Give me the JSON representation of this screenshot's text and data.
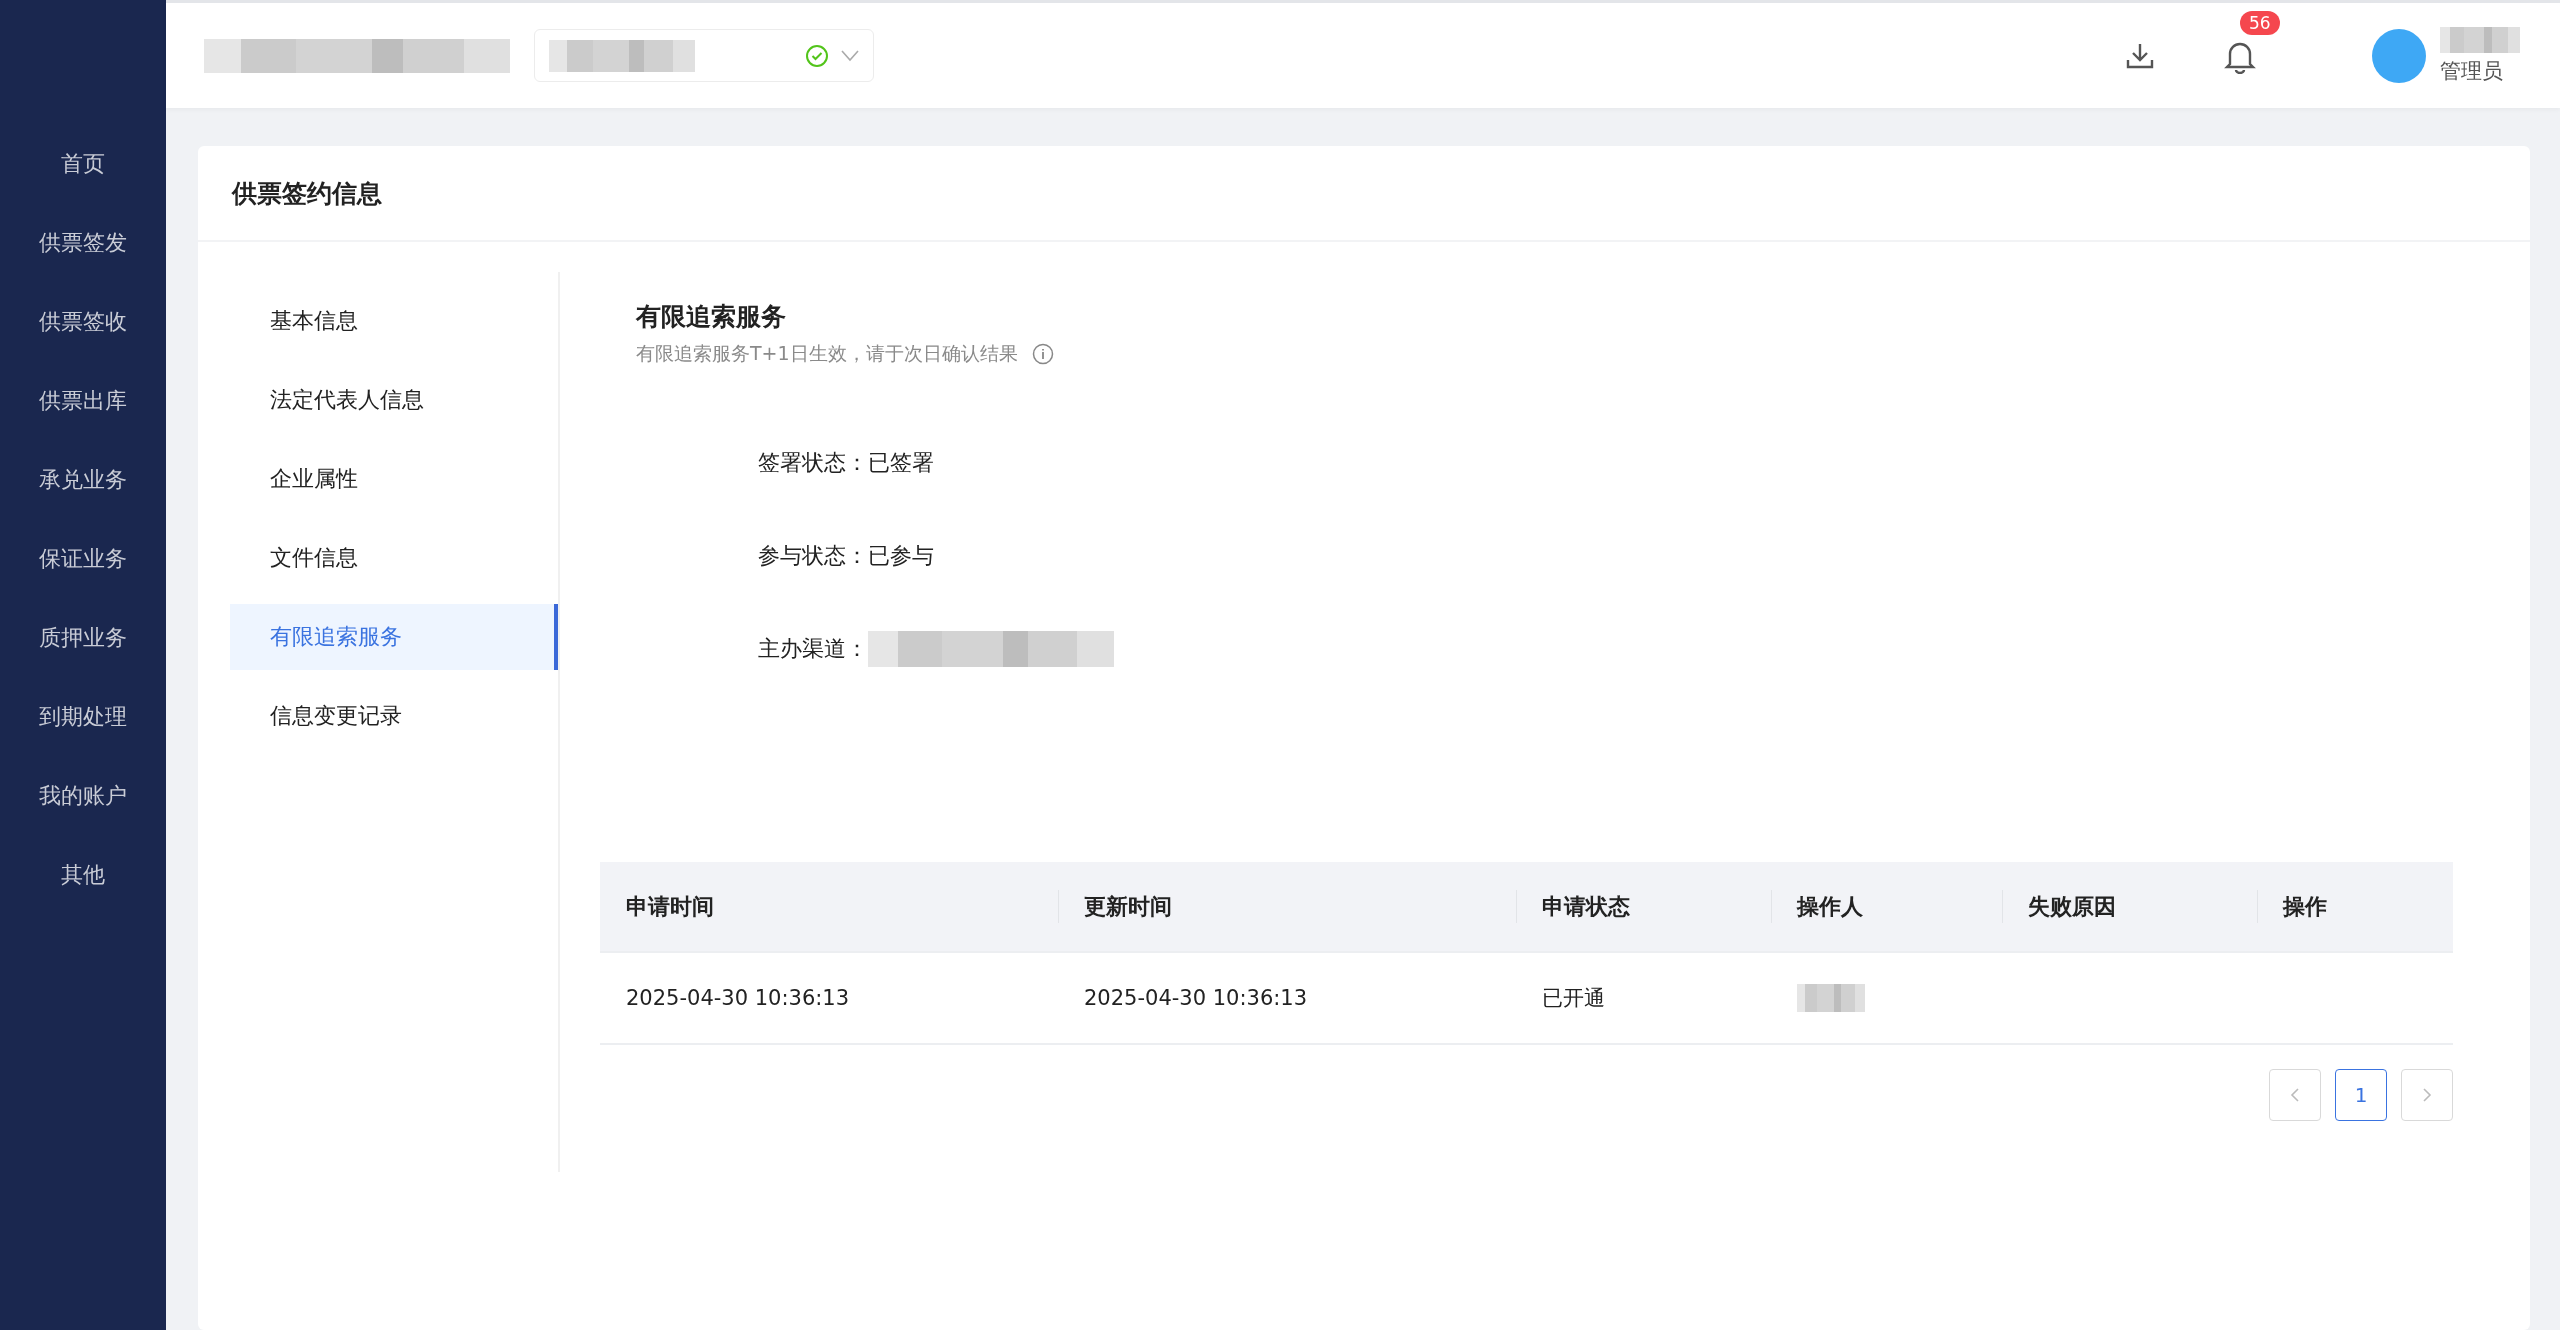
{
  "sidebar": {
    "items": [
      {
        "label": "首页",
        "selected": false
      },
      {
        "label": "供票签发",
        "selected": false
      },
      {
        "label": "供票签收",
        "selected": false
      },
      {
        "label": "供票出库",
        "selected": false
      },
      {
        "label": "承兑业务",
        "selected": false
      },
      {
        "label": "保证业务",
        "selected": false
      },
      {
        "label": "质押业务",
        "selected": false
      },
      {
        "label": "到期处理",
        "selected": false
      },
      {
        "label": "我的账户",
        "selected": false
      },
      {
        "label": "其他",
        "selected": false
      }
    ]
  },
  "header": {
    "notification_count": "56",
    "user_role": "管理员"
  },
  "card": {
    "title": "供票签约信息"
  },
  "sub_nav": {
    "items": [
      {
        "label": "基本信息",
        "selected": false
      },
      {
        "label": "法定代表人信息",
        "selected": false
      },
      {
        "label": "企业属性",
        "selected": false
      },
      {
        "label": "文件信息",
        "selected": false
      },
      {
        "label": "有限追索服务",
        "selected": true
      },
      {
        "label": "信息变更记录",
        "selected": false
      }
    ]
  },
  "section": {
    "title": "有限追索服务",
    "hint": "有限追索服务T+1日生效，请于次日确认结果"
  },
  "fields": [
    {
      "label": "签署状态：",
      "value": "已签署"
    },
    {
      "label": "参与状态：",
      "value": "已参与"
    },
    {
      "label": "主办渠道："
    }
  ],
  "table": {
    "columns": [
      "申请时间",
      "更新时间",
      "申请状态",
      "操作人",
      "失败原因",
      "操作"
    ],
    "rows": [
      {
        "cells": [
          "2025-04-30 10:36:13",
          "2025-04-30 10:36:13",
          "已开通",
          null,
          null,
          null
        ]
      }
    ]
  },
  "pagination": {
    "pages": [
      {
        "label": "1",
        "selected": true
      }
    ]
  }
}
